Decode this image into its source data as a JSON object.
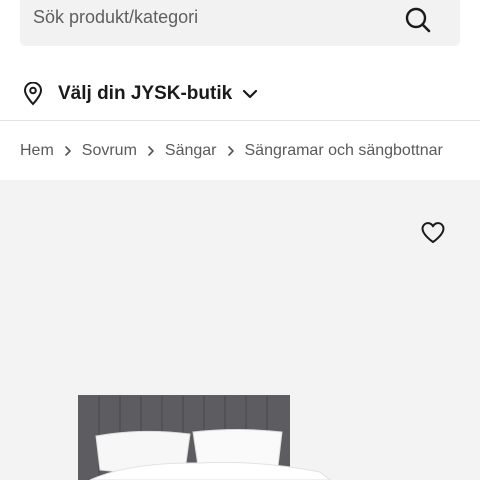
{
  "search": {
    "placeholder": "Sök produkt/kategori",
    "icon": "search-icon"
  },
  "store": {
    "label": "Välj din JYSK-butik",
    "icon": "location-pin-icon",
    "chevron": "chevron-down-icon"
  },
  "breadcrumb": {
    "items": [
      "Hem",
      "Sovrum",
      "Sängar",
      "Sängramar och sängbottnar"
    ],
    "separator_icon": "chevron-right-icon"
  },
  "product": {
    "favorite_icon": "heart-icon",
    "image": "bed-with-grey-upholstered-headboard-and-white-pillows"
  },
  "colors": {
    "search_bg": "#f2f2f2",
    "product_bg": "#f3f3f3",
    "headboard": "#5d5d61",
    "text": "#1f1f1f"
  }
}
